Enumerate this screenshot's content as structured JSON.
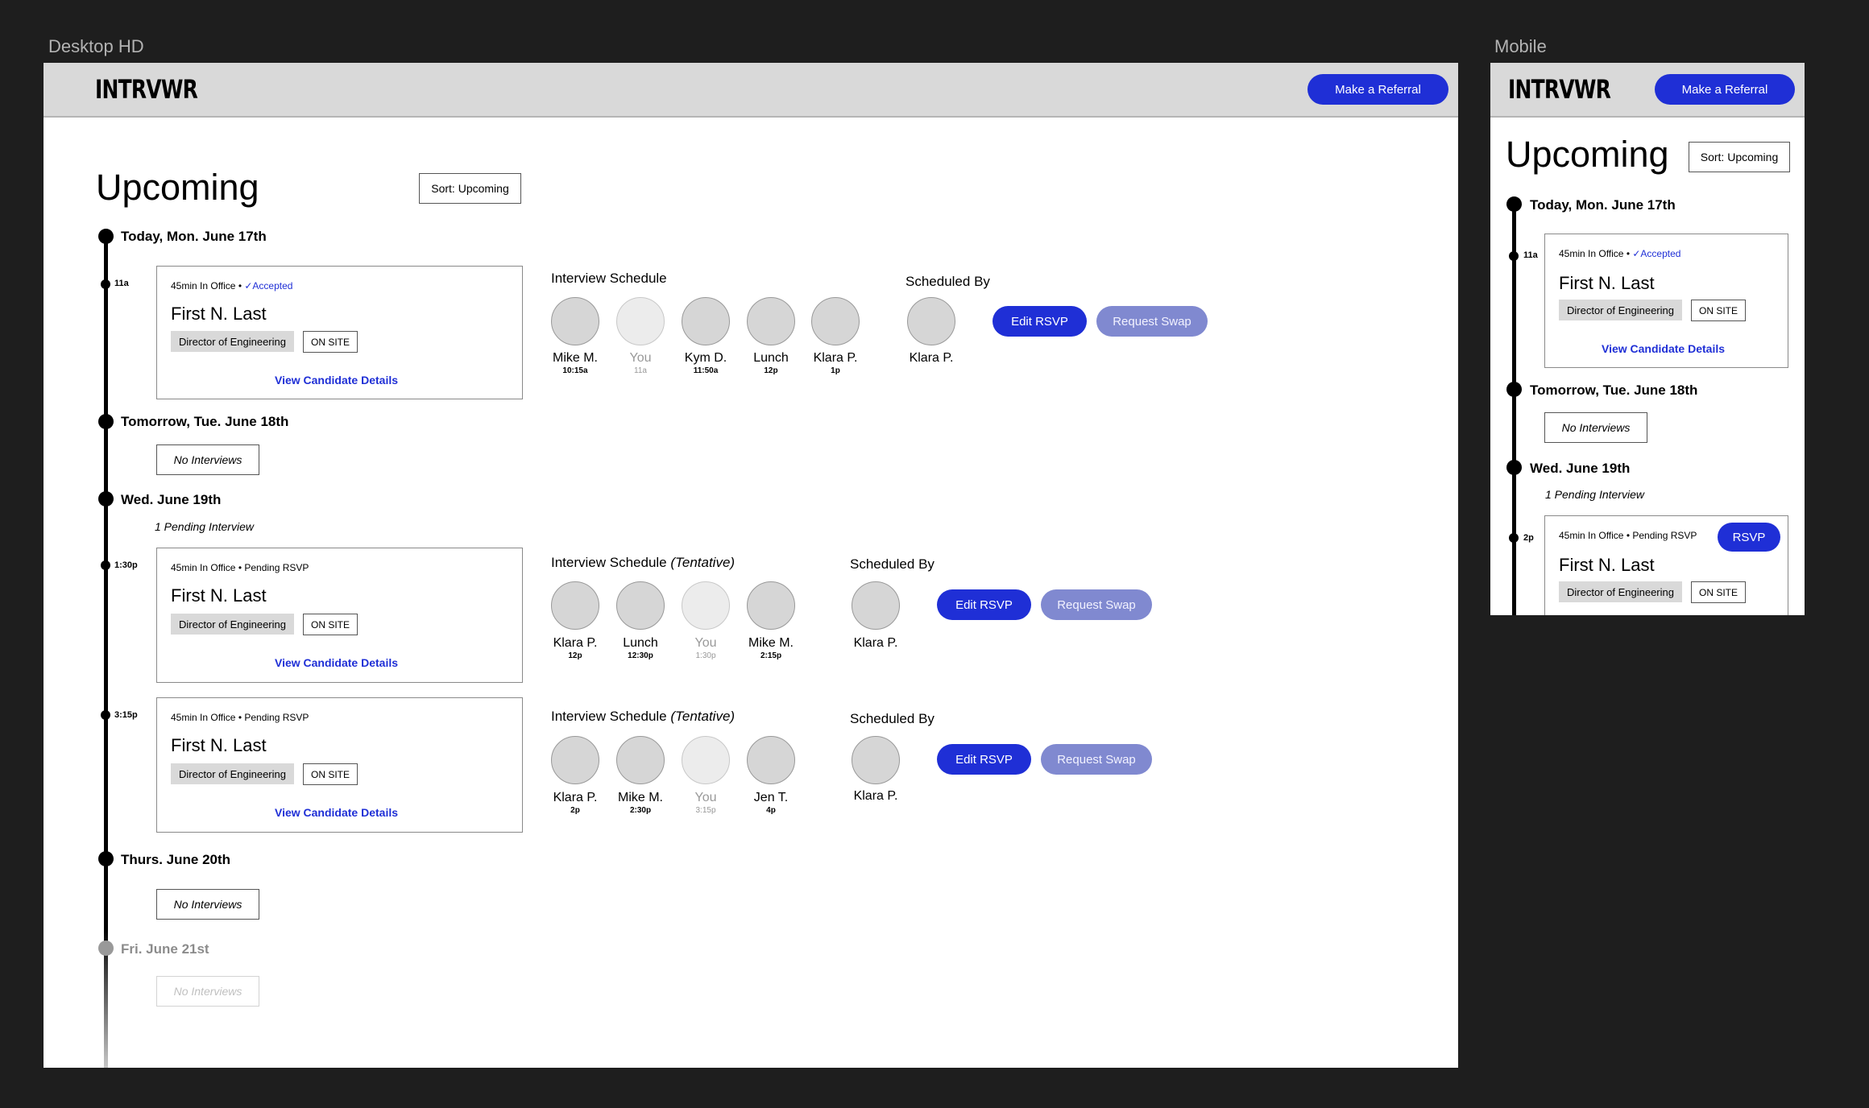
{
  "frames": {
    "desktop_label": "Desktop HD",
    "mobile_label": "Mobile"
  },
  "header": {
    "logo": "INTRVWR",
    "referral_button": "Make a Referral"
  },
  "page": {
    "title": "Upcoming",
    "sort_button": "Sort: Upcoming"
  },
  "labels": {
    "schedule": "Interview Schedule",
    "tentative": "(Tentative)",
    "scheduled_by": "Scheduled By",
    "edit_rsvp": "Edit RSVP",
    "request_swap": "Request Swap",
    "view_details": "View Candidate Details",
    "no_interviews": "No Interviews",
    "onsite": "ON SITE",
    "rsvp": "RSVP"
  },
  "days": {
    "today": "Today, Mon. June 17th",
    "tomorrow": "Tomorrow, Tue. June 18th",
    "wed": "Wed. June 19th",
    "wed_pending": "1 Pending Interview",
    "thu": "Thurs. June 20th",
    "fri": "Fri. June 21st"
  },
  "interviews": [
    {
      "time": "11a",
      "meta": "45min In Office • ",
      "status": "✓Accepted",
      "candidate": "First N. Last",
      "role": "Director of Engineering",
      "schedule": [
        {
          "name": "Mike M.",
          "time": "10:15a",
          "you": false
        },
        {
          "name": "You",
          "time": "11a",
          "you": true
        },
        {
          "name": "Kym D.",
          "time": "11:50a",
          "you": false
        },
        {
          "name": "Lunch",
          "time": "12p",
          "you": false
        },
        {
          "name": "Klara P.",
          "time": "1p",
          "you": false
        }
      ],
      "scheduled_by": "Klara P."
    },
    {
      "time": "1:30p",
      "meta": "45min In Office • Pending RSVP",
      "status": "",
      "candidate": "First N. Last",
      "role": "Director of Engineering",
      "schedule": [
        {
          "name": "Klara P.",
          "time": "12p",
          "you": false
        },
        {
          "name": "Lunch",
          "time": "12:30p",
          "you": false
        },
        {
          "name": "You",
          "time": "1:30p",
          "you": true
        },
        {
          "name": "Mike M.",
          "time": "2:15p",
          "you": false
        }
      ],
      "scheduled_by": "Klara P."
    },
    {
      "time": "3:15p",
      "meta": "45min In Office • Pending RSVP",
      "status": "",
      "candidate": "First N. Last",
      "role": "Director of Engineering",
      "schedule": [
        {
          "name": "Klara P.",
          "time": "2p",
          "you": false
        },
        {
          "name": "Mike M.",
          "time": "2:30p",
          "you": false
        },
        {
          "name": "You",
          "time": "3:15p",
          "you": true
        },
        {
          "name": "Jen T.",
          "time": "4p",
          "you": false
        }
      ],
      "scheduled_by": "Klara P."
    }
  ],
  "mobile": {
    "card1_time": "11a",
    "card2_time": "2p",
    "card2_meta": "45min In Office • Pending RSVP"
  },
  "colors": {
    "accent": "#1f2fd6",
    "secondary": "#8089d0",
    "canvas": "#1e1e1e",
    "header": "#d9d9d9"
  }
}
